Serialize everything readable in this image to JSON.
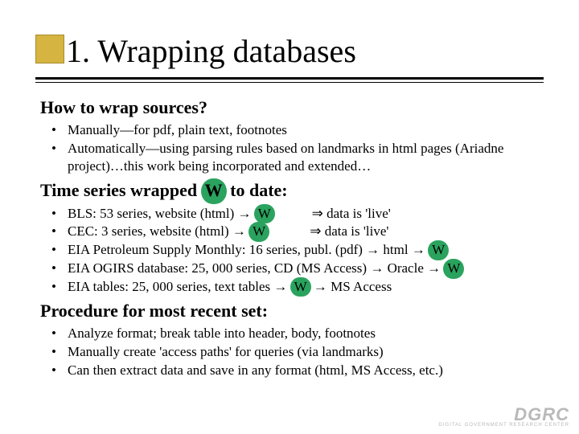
{
  "title": "1. Wrapping databases",
  "sections": {
    "howto": {
      "heading": "How to wrap sources?",
      "items": [
        "Manually—for pdf, plain text, footnotes",
        "Automatically—using parsing rules based on landmarks in html pages (Ariadne project)…this work being incorporated and extended…"
      ]
    },
    "wrapped": {
      "heading_pre": "Time series wrapped",
      "heading_bap": "W",
      "heading_post": " to date:",
      "items": [
        {
          "pre": "BLS: 53 series, website (html)  ",
          "arrow": "→",
          "bap": "W",
          "gap": "           ",
          "darrow": "⇒",
          "tail": " data is 'live'"
        },
        {
          "pre": "CEC: 3 series, website (html)  ",
          "arrow": "→",
          "bap": "W",
          "gap": "            ",
          "darrow": "⇒",
          "tail": " data is 'live'"
        },
        {
          "pre": "EIA Petroleum Supply Monthly: 16 series, publ. (pdf)  ",
          "arrow": "→",
          "mid": " html ",
          "arrow2": "→",
          "bap": "W"
        },
        {
          "pre": "EIA OGIRS database: 25, 000 series, CD (MS Access)  ",
          "arrow": "→",
          "mid": " Oracle  ",
          "arrow2": "→",
          "bap": "W"
        },
        {
          "pre": "EIA tables: 25, 000 series, text tables  ",
          "arrow": "→",
          "bap": "W",
          "gap": " ",
          "arrow2": "→",
          "tail": " MS Access"
        }
      ]
    },
    "procedure": {
      "heading": "Procedure for most recent set:",
      "items": [
        "Analyze format; break table into header, body, footnotes",
        "Manually create 'access paths' for queries (via landmarks)",
        "Can then extract data and save in any format (html, MS Access, etc.)"
      ]
    }
  },
  "logo": {
    "main": "DGRC",
    "sub": "DIGITAL GOVERNMENT RESEARCH CENTER"
  }
}
